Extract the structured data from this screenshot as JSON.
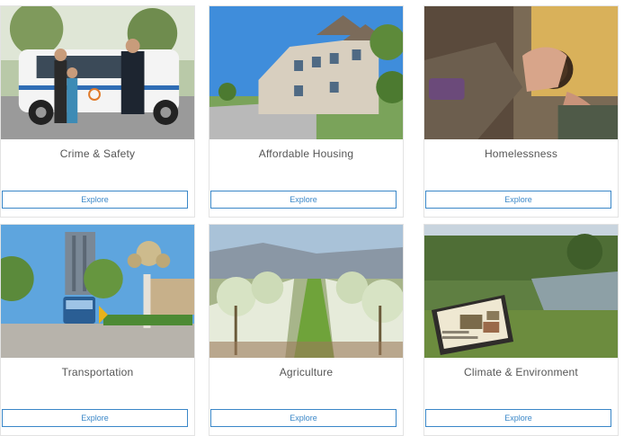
{
  "cards": [
    {
      "title": "Crime & Safety",
      "button": "Explore"
    },
    {
      "title": "Affordable Housing",
      "button": "Explore"
    },
    {
      "title": "Homelessness",
      "button": "Explore"
    },
    {
      "title": "Transportation",
      "button": "Explore"
    },
    {
      "title": "Agriculture",
      "button": "Explore"
    },
    {
      "title": "Climate & Environment",
      "button": "Explore"
    }
  ],
  "colors": {
    "accent": "#3a87c8",
    "title_text": "#555555",
    "card_border": "#e3e3e3"
  }
}
